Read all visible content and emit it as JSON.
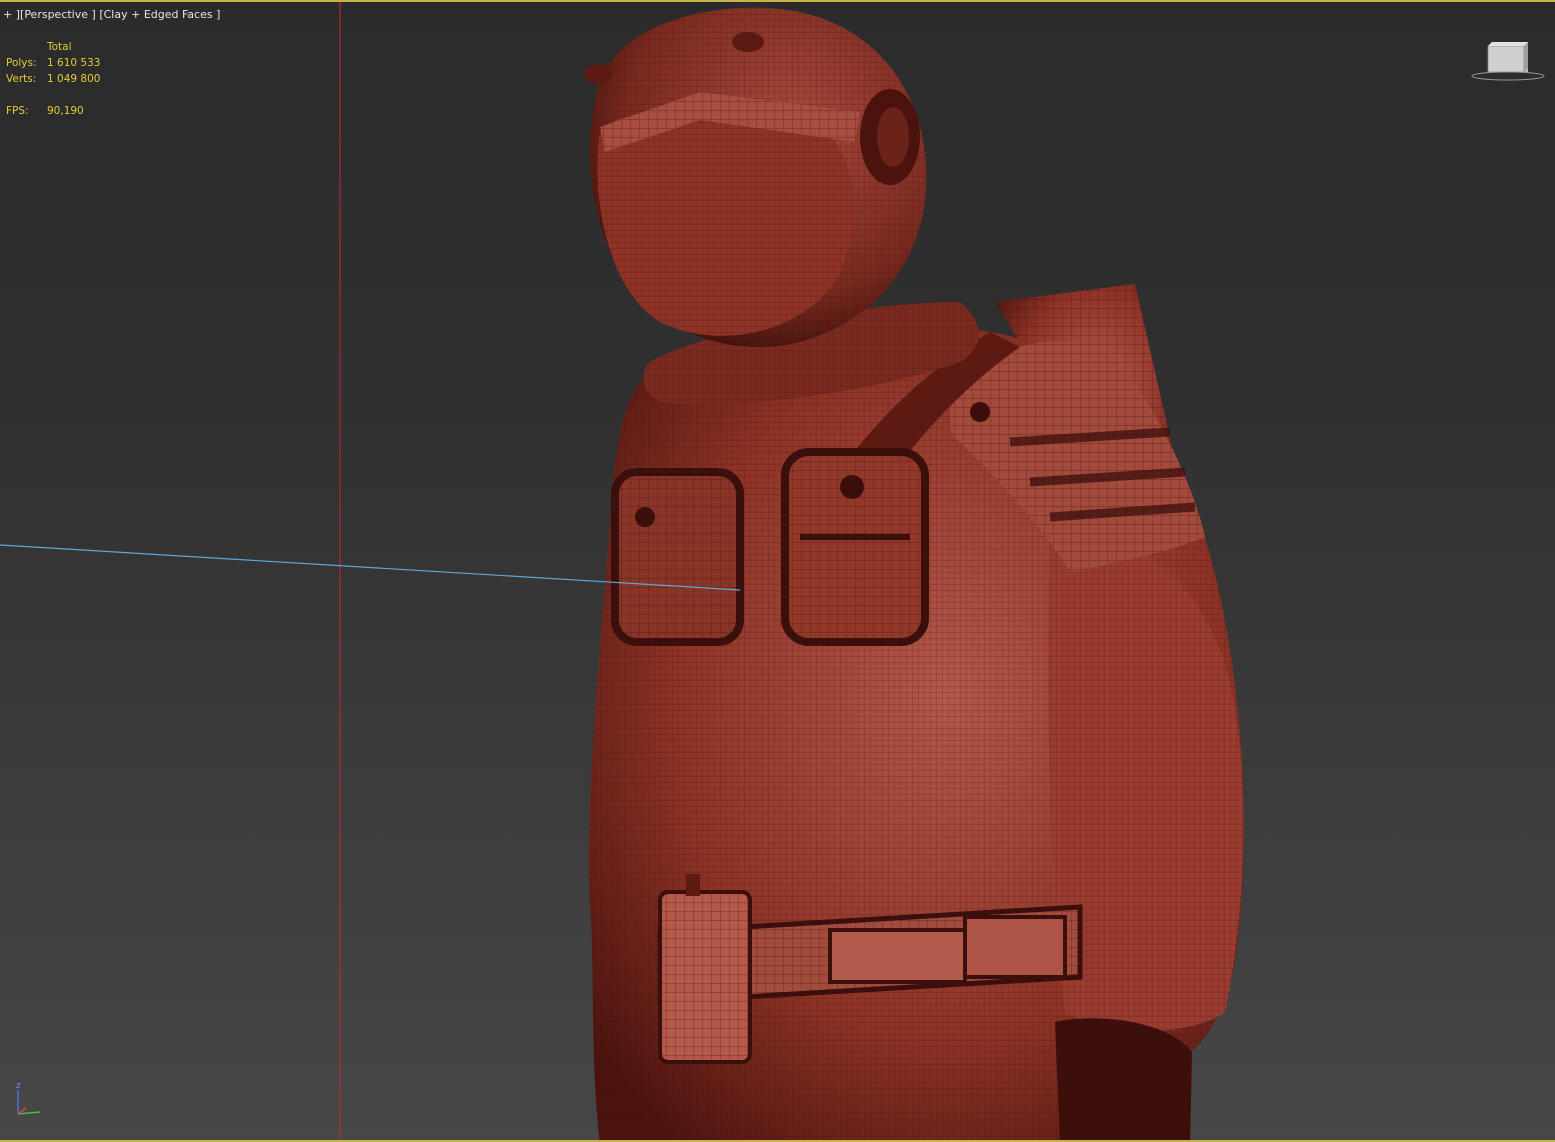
{
  "viewport": {
    "label_parts": [
      "+",
      "Perspective",
      "Clay + Edged Faces"
    ],
    "label_separators": {
      "open": "[",
      "close": "]"
    }
  },
  "stats": {
    "header": "Total",
    "polys_label": "Polys:",
    "polys_value": "1 610 533",
    "verts_label": "Verts:",
    "verts_value": "1 049 800",
    "fps_label": "FPS:",
    "fps_value": "90,190"
  },
  "scene": {
    "model_color": "#8e3326",
    "model_shadow": "#4a130e",
    "model_highlight": "#b2564a",
    "wire_color": "#3a0f0b",
    "grid_line_color": "#c0292e",
    "selection_line_color": "#5fa7d9"
  },
  "viewcube": {
    "icon": "viewcube-icon"
  },
  "axis_tripod": {
    "icon": "axis-tripod-icon",
    "z_label": "z"
  }
}
